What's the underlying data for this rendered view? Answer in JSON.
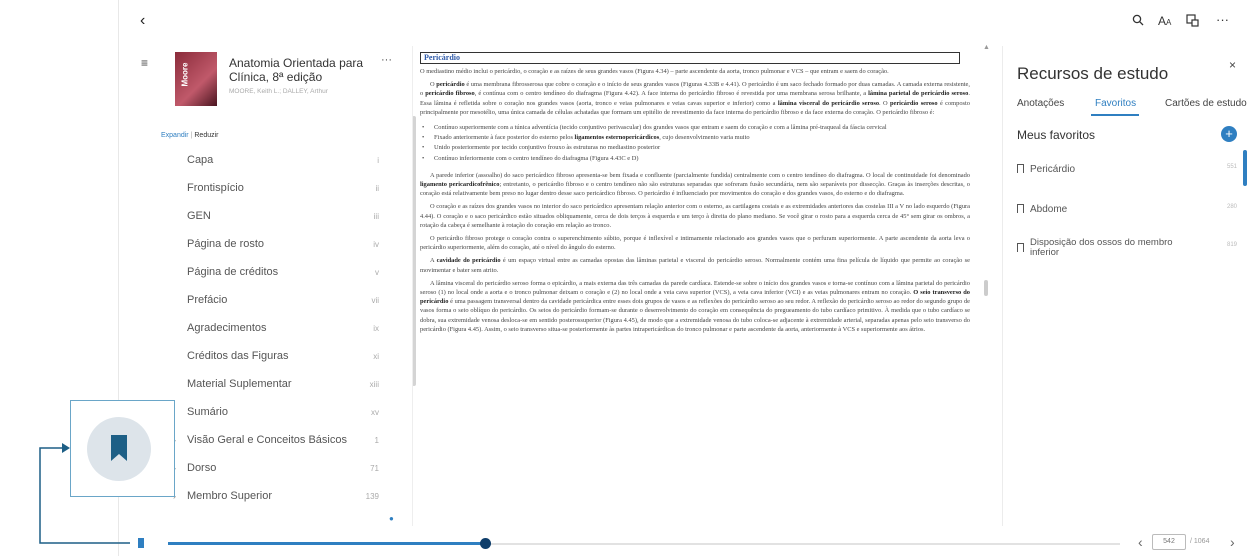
{
  "topbar": {
    "back_icon": "chevron-left-icon",
    "search_icon": "search-icon",
    "font_label": "A",
    "font_label_small": "A",
    "more_label": "···"
  },
  "book": {
    "title_line1": "Anatomia Orientada para",
    "title_line2": "Clínica, 8ª edição",
    "author": "MOORE, Keith L.; DALLEY, Arthur",
    "cover_text": "Moore",
    "more": "···",
    "expand": "Expandir",
    "separator": "|",
    "collapse": "Reduzir"
  },
  "toc": [
    {
      "label": "Capa",
      "page": "i"
    },
    {
      "label": "Frontispício",
      "page": "ii"
    },
    {
      "label": "GEN",
      "page": "iii"
    },
    {
      "label": "Página de rosto",
      "page": "iv"
    },
    {
      "label": "Página de créditos",
      "page": "v"
    },
    {
      "label": "Prefácio",
      "page": "vii"
    },
    {
      "label": "Agradecimentos",
      "page": "ix"
    },
    {
      "label": "Créditos das Figuras",
      "page": "xi"
    },
    {
      "label": "Material Suplementar",
      "page": "xiii"
    },
    {
      "label": "Sumário",
      "page": "xv"
    },
    {
      "label": "Visão Geral e Conceitos Básicos",
      "page": "1"
    },
    {
      "label": "Dorso",
      "page": "71"
    },
    {
      "label": "Membro Superior",
      "page": "139"
    }
  ],
  "document": {
    "heading": "Pericárdio",
    "p1": "O mediastino médio inclui o pericárdio, o coração e as raízes de seus grandes vasos (Figura 4.34) – parte ascendente da aorta, tronco pulmonar e VCS – que entram e saem do coração.",
    "p2a": "O ",
    "p2b": "pericárdio",
    "p2c": " é uma membrana fibrosserosa que cobre o coração e o início de seus grandes vasos (Figuras 4.33B e 4.41). O pericárdio é um saco fechado formado por duas camadas. A camada externa resistente, o ",
    "p2d": "pericárdio fibroso",
    "p2e": ", é contínua com o centro tendíneo do diafragma (Figura 4.42). A face interna do pericárdio fibroso é revestida por uma membrana serosa brilhante, a ",
    "p2f": "lâmina parietal do pericárdio seroso",
    "p2g": ". Essa lâmina é refletida sobre o coração nos grandes vasos (aorta, tronco e veias pulmonares e veias cavas superior e inferior) como a ",
    "p2h": "lâmina visceral do pericárdio seroso",
    "p2i": ". O ",
    "p2j": "pericárdio seroso",
    "p2k": " é composto principalmente por mesotélio, uma única camada de células achatadas que formam um epitélio de revestimento da face interna do pericárdio fibroso e da face externa do coração. O pericárdio fibroso é:",
    "li1": "Contínuo superiormente com a túnica adventícia (tecido conjuntivo perivascular) dos grandes vasos que entram e saem do coração e com a lâmina pré-traqueal da fáscia cervical",
    "li2a": "Fixado anteriormente à face posterior do esterno pelos ",
    "li2b": "ligamentos esternopericárdicos",
    "li2c": ", cujo desenvolvimento varia muito",
    "li3": "Unido posteriormente por tecido conjuntivo frouxo às estruturas no mediastino posterior",
    "li4": "Contínuo inferiormente com o centro tendíneo do diafragma (Figura 4.43C e D)",
    "p3a": "A parede inferior (assoalho) do saco pericárdico fibroso apresenta-se bem fixada e confluente (parcialmente fundida) centralmente com o centro tendíneo do diafragma. O local de continuidade foi denominado ",
    "p3b": "ligamento pericardicofrênico",
    "p3c": "; entretanto, o pericárdio fibroso e o centro tendíneo não são estruturas separadas que sofreram fusão secundária, nem são separáveis por dissecção. Graças às inserções descritas, o coração está relativamente bem preso no lugar dentro desse saco pericárdico fibroso. O pericárdio é influenciado por movimentos do coração e dos grandes vasos, do esterno e do diafragma.",
    "p4": "O coração e as raízes dos grandes vasos no interior do saco pericárdico apresentam relação anterior com o esterno, as cartilagens costais e as extremidades anteriores das costelas III a V no lado esquerdo (Figura 4.44). O coração e o saco pericárdico estão situados obliquamente, cerca de dois terços à esquerda e um terço à direita do plano mediano. Se você girar o rosto para a esquerda cerca de 45° sem girar os ombros, a rotação da cabeça é semelhante à rotação do coração em relação ao tronco.",
    "p5": "O pericárdio fibroso protege o coração contra o superenchimento súbito, porque é inflexível e intimamente relacionado aos grandes vasos que o perfuram superiormente. A parte ascendente da aorta leva o pericárdio superiormente, além do coração, até o nível do ângulo do esterno.",
    "p6a": "A ",
    "p6b": "cavidade do pericárdio",
    "p6c": " é um espaço virtual entre as camadas opostas das lâminas parietal e visceral do pericárdio seroso. Normalmente contém uma fina película de líquido que permite ao coração se movimentar e bater sem atrito.",
    "p7a": "A lâmina visceral do pericárdio seroso forma o epicárdio, a mais externa das três camadas da parede cardíaca. Estende-se sobre o início dos grandes vasos e torna-se contínuo com a lâmina parietal do pericárdio seroso (1) no local onde a aorta e o tronco pulmonar deixam o coração e (2) no local onde a veia cava superior (VCS), a veia cava inferior (VCI) e as veias pulmonares entram no coração. ",
    "p7b": "O seio transverso do pericárdio",
    "p7c": " é uma passagem transversal dentro da cavidade pericárdica entre esses dois grupos de vasos e as reflexões do pericárdio seroso ao seu redor. A reflexão do pericárdio seroso ao redor do segundo grupo de vasos forma o seio oblíquo do pericárdio. Os seios do pericárdio formam-se durante o desenvolvimento do coração em consequência do pregueamento do tubo cardíaco primitivo. À medida que o tubo cardíaco se dobra, sua extremidade venosa desloca-se em sentido posterossuperior (Figura 4.45), de modo que a extremidade venosa do tubo coloca-se adjacente à extremidade arterial, separadas apenas pelo seio transverso do pericárdio (Figura 4.45). Assim, o seio transverso situa-se posteriormente às partes intrapericárdicas do tronco pulmonar e parte ascendente da aorta, anteriormente à VCS e superiormente aos átrios."
  },
  "panel": {
    "title": "Recursos de estudo",
    "close": "×",
    "tabs": [
      "Anotações",
      "Favoritos",
      "Cartões de estudo"
    ],
    "section_title": "Meus favoritos",
    "add": "+",
    "favorites": [
      {
        "label": "Pericárdio",
        "page": "551"
      },
      {
        "label": "Abdome",
        "page": "280"
      },
      {
        "label": "Disposição dos ossos do membro inferior",
        "page": "819"
      }
    ],
    "accent": "#2f7fc1"
  },
  "bottom": {
    "page_value": "542",
    "total": "/ 1064",
    "progress": 0.34
  }
}
